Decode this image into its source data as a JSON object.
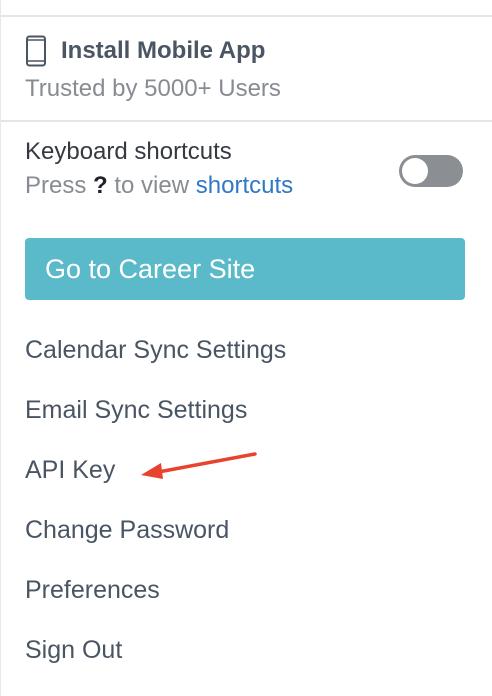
{
  "install": {
    "title": "Install Mobile App",
    "subtitle": "Trusted by 5000+ Users",
    "icon": "mobile-phone-icon"
  },
  "shortcuts": {
    "title": "Keyboard shortcuts",
    "press_text": "Press",
    "key": "?",
    "to_view_text": "to view",
    "link_text": "shortcuts",
    "toggle_on": false
  },
  "career_button": {
    "label": "Go to Career Site",
    "color": "#5bbac9"
  },
  "menu": {
    "items": [
      {
        "label": "Calendar Sync Settings"
      },
      {
        "label": "Email Sync Settings"
      },
      {
        "label": "API Key"
      },
      {
        "label": "Change Password"
      },
      {
        "label": "Preferences"
      },
      {
        "label": "Sign Out"
      }
    ]
  },
  "annotation": {
    "arrow_color": "#e8432e"
  }
}
